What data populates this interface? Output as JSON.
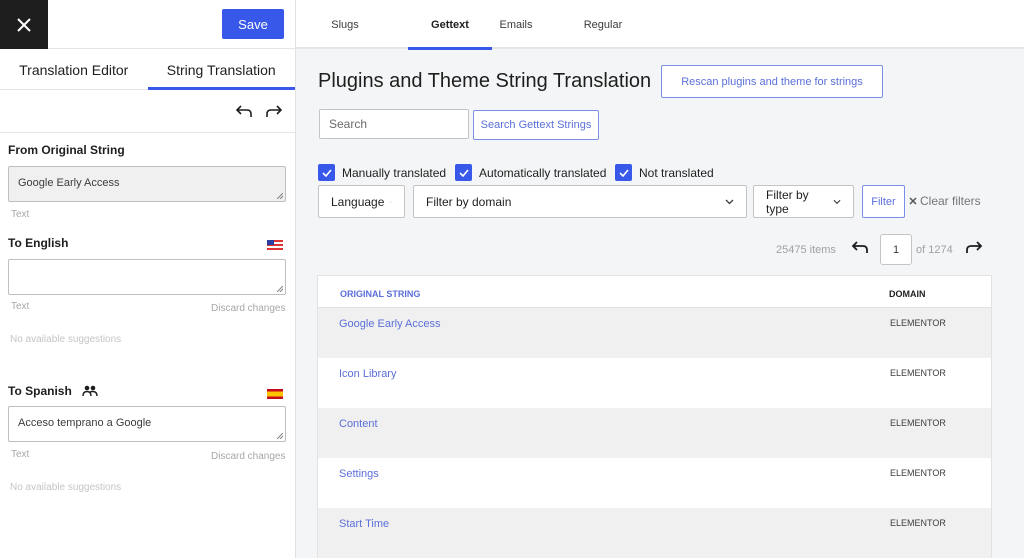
{
  "sidebar": {
    "save_label": "Save",
    "tabs": [
      {
        "label": "Translation Editor",
        "active": false
      },
      {
        "label": "String Translation",
        "active": true
      }
    ],
    "from_original": {
      "label": "From Original String",
      "value": "Google Early Access",
      "type_label": "Text"
    },
    "to_english": {
      "label": "To English",
      "flag": "us-flag",
      "value": "",
      "type_label": "Text",
      "discard_label": "Discard changes",
      "suggestions": "No available suggestions"
    },
    "to_spanish": {
      "label": "To Spanish",
      "flag": "es-flag",
      "value": "Acceso temprano a Google",
      "type_label": "Text",
      "discard_label": "Discard changes",
      "suggestions": "No available suggestions"
    }
  },
  "main": {
    "tabs": [
      {
        "label": "Slugs",
        "active": false
      },
      {
        "label": "Gettext",
        "active": true
      },
      {
        "label": "Emails",
        "active": false
      },
      {
        "label": "Regular",
        "active": false
      }
    ],
    "title": "Plugins and Theme String Translation",
    "rescan_label": "Rescan plugins and theme for strings",
    "search_placeholder": "Search",
    "search_button": "Search Gettext Strings",
    "checkboxes": [
      {
        "label": "Manually translated",
        "checked": true
      },
      {
        "label": "Automatically translated",
        "checked": true
      },
      {
        "label": "Not translated",
        "checked": true
      }
    ],
    "filters": {
      "language": "Language",
      "domain": "Filter by domain",
      "type": "Filter by type",
      "filter_button": "Filter",
      "clear": "Clear filters"
    },
    "pagination": {
      "items": "25475 items",
      "page": "1",
      "of": "of 1274"
    },
    "table": {
      "columns": [
        "ORIGINAL STRING",
        "DOMAIN"
      ],
      "rows": [
        {
          "original": "Google Early Access",
          "domain": "ELEMENTOR"
        },
        {
          "original": "Icon Library",
          "domain": "ELEMENTOR"
        },
        {
          "original": "Content",
          "domain": "ELEMENTOR"
        },
        {
          "original": "Settings",
          "domain": "ELEMENTOR"
        },
        {
          "original": "Start Time",
          "domain": "ELEMENTOR"
        }
      ]
    }
  },
  "colors": {
    "accent": "#3858e9",
    "link": "#5b6fd9",
    "dark": "#1e1e1e"
  }
}
